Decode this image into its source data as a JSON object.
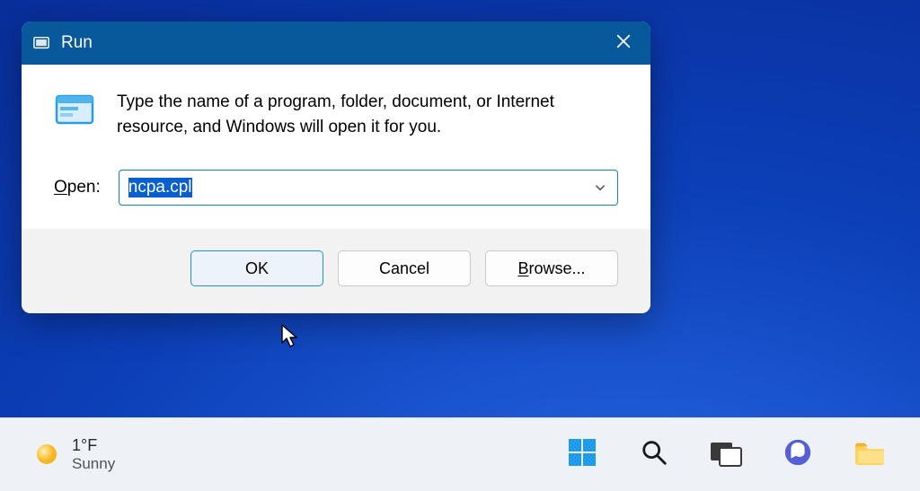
{
  "dialog": {
    "title": "Run",
    "description": "Type the name of a program, folder, document, or Internet resource, and Windows will open it for you.",
    "open_label_pre": "O",
    "open_label_rest": "pen:",
    "input_value": "ncpa.cpl",
    "ok_label": "OK",
    "cancel_label": "Cancel",
    "browse_label_pre": "B",
    "browse_label_rest": "rowse..."
  },
  "taskbar": {
    "temperature": "1°F",
    "condition": "Sunny"
  }
}
